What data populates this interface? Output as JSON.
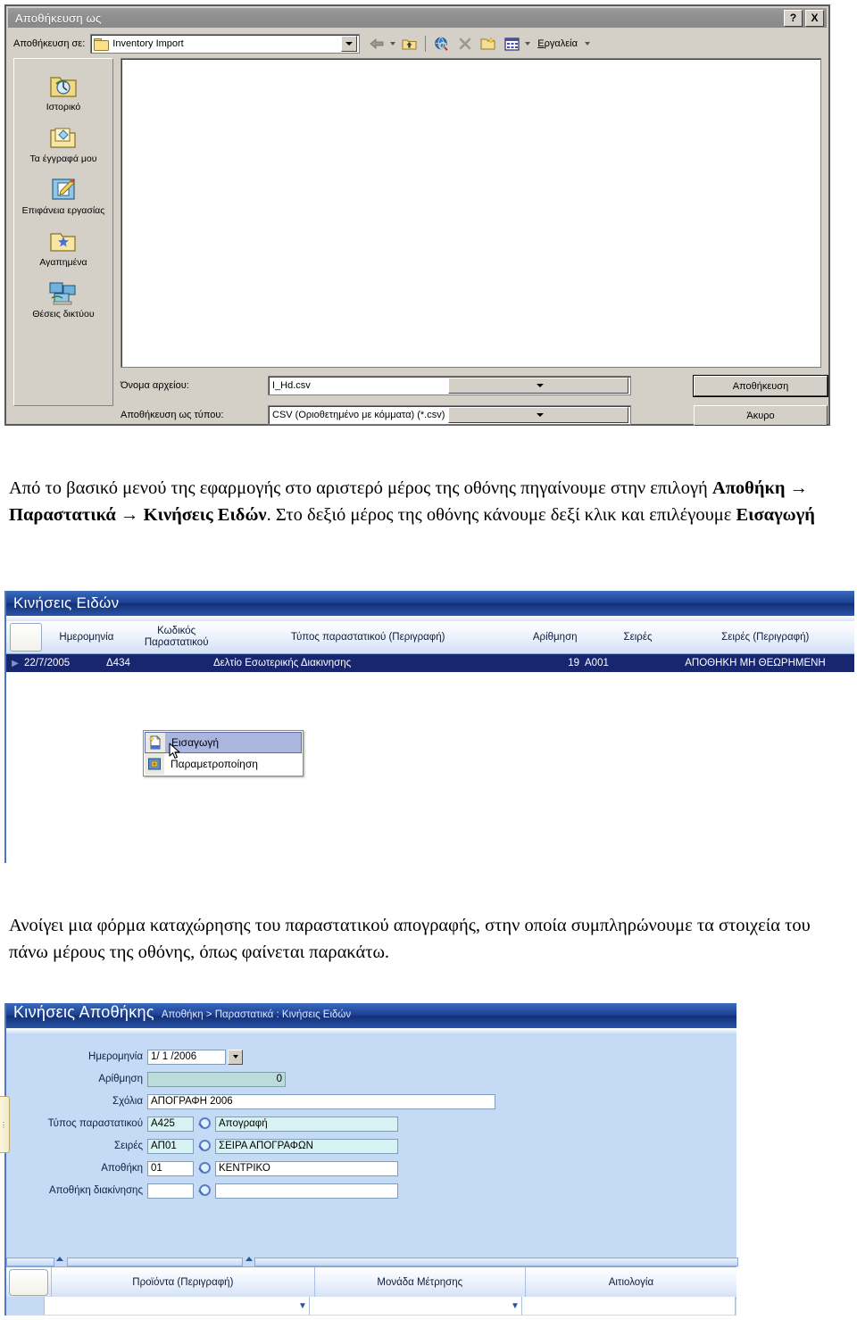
{
  "save_dialog": {
    "title": "Αποθήκευση ως",
    "help_button": "?",
    "close_button": "X",
    "save_in_label": "Αποθήκευση σε:",
    "save_in_value": "Inventory Import",
    "toolbar": {
      "back": "back-arrow",
      "up_one_level": "up-folder",
      "search_web": "search-web",
      "delete": "delete",
      "new_folder": "new-folder",
      "views": "views",
      "tools_label": "Εργαλεία"
    },
    "places": [
      {
        "label": "Ιστορικό",
        "icon": "history-folder-icon"
      },
      {
        "label": "Τα έγγραφά μου",
        "icon": "my-documents-icon"
      },
      {
        "label": "Επιφάνεια εργασίας",
        "icon": "desktop-icon"
      },
      {
        "label": "Αγαπημένα",
        "icon": "favorites-icon"
      },
      {
        "label": "Θέσεις δικτύου",
        "icon": "network-places-icon"
      }
    ],
    "file_name_label": "Όνομα αρχείου:",
    "file_name_value": "I_Hd.csv",
    "file_type_label": "Αποθήκευση ως τύπου:",
    "file_type_value": "CSV (Οριοθετημένο με κόμματα) (*.csv)",
    "save_button": "Αποθήκευση",
    "cancel_button": "Άκυρο"
  },
  "paragraph_1": {
    "part_1": "Από το βασικό μενού της εφαρμογής στο αριστερό μέρος της οθόνης πηγαίνουμε στην επιλογή ",
    "bold_1": "Αποθήκη",
    "arrow_1": " → ",
    "bold_2": "Παραστατικά",
    "arrow_2": " → ",
    "bold_3": "Κινήσεις Ειδών",
    "part_2": ". Στο δεξιό μέρος της οθόνης κάνουμε δεξί κλικ και επιλέγουμε ",
    "bold_4": "Εισαγωγή"
  },
  "item_movements_window": {
    "title": "Κινήσεις Ειδών",
    "columns": [
      "Ημερομηνία",
      "Κωδικός Παραστατικού",
      "Τύπος παραστατικού (Περιγραφή)",
      "Αρίθμηση",
      "Σειρές",
      "Σειρές (Περιγραφή)"
    ],
    "row": {
      "date": "22/7/2005",
      "doc_code": "Δ434",
      "doc_type": "Δελτίο Εσωτερικής Διακινησης",
      "numbering": "19",
      "series": "A001",
      "series_desc": "ΑΠΟΘΗΚΗ ΜΗ ΘΕΩΡΗΜΕΝΗ"
    },
    "context_menu": [
      {
        "label": "Εισαγωγή",
        "icon": "new-document-icon",
        "selected": true
      },
      {
        "label": "Παραμετροποίηση",
        "icon": "settings-icon",
        "selected": false
      }
    ]
  },
  "paragraph_2": {
    "text": "Ανοίγει μια φόρμα καταχώρησης του παραστατικού απογραφής, στην οποία συμπληρώνουμε τα στοιχεία του πάνω μέρους της οθόνης, όπως φαίνεται παρακάτω."
  },
  "warehouse_movements_form": {
    "title": "Κινήσεις Αποθήκης",
    "breadcrumb": "Αποθήκη > Παραστατικά : Κινήσεις Ειδών",
    "side_tab": "⋮",
    "fields": [
      {
        "label": "Ημερομηνία",
        "value": "1/ 1 /2006",
        "type": "date"
      },
      {
        "label": "Αρίθμηση",
        "value": "0",
        "type": "readonly"
      },
      {
        "label": "Σχόλια",
        "value": "ΑΠΟΓΡΑΦΗ 2006",
        "type": "text"
      },
      {
        "label": "Τύπος παραστατικού",
        "code": "Α425",
        "desc": "Απογραφή",
        "type": "lookup-teal"
      },
      {
        "label": "Σειρές",
        "code": "ΑΠ01",
        "desc": "ΣΕΙΡΑ ΑΠΟΓΡΑΦΩΝ",
        "type": "lookup-teal"
      },
      {
        "label": "Αποθήκη",
        "code": "01",
        "desc": "ΚΕΝΤΡΙΚΟ",
        "type": "lookup"
      },
      {
        "label": "Αποθήκη διακίνησης",
        "code": "",
        "desc": "",
        "type": "lookup"
      }
    ],
    "grid_columns": [
      "Προϊόντα (Περιγραφή)",
      "Μονάδα Μέτρησης",
      "Αιτιολογία"
    ],
    "grid_row": [
      "",
      "",
      ""
    ]
  },
  "colors": {
    "title_blue_dark": "#123077",
    "title_blue_light": "#3a6bbd",
    "form_background": "#c5daf5",
    "selected_row": "#17266e",
    "dialog_face": "#d4d0c8",
    "lookup_teal": "#d6f2f2",
    "readonly_teal": "#bcdcdc"
  }
}
